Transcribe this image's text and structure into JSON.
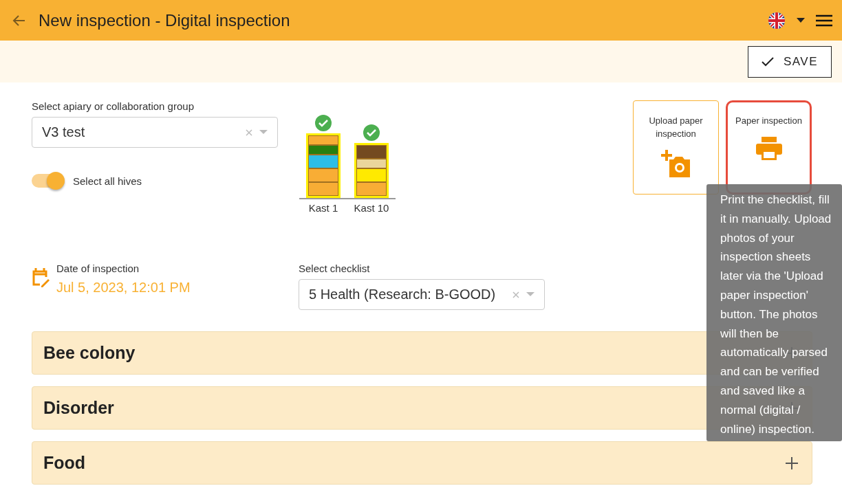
{
  "header": {
    "title": "New inspection - Digital inspection"
  },
  "toolbar": {
    "save_label": "SAVE"
  },
  "apiary": {
    "label": "Select apiary or collaboration group",
    "value": "V3 test"
  },
  "select_all": {
    "label": "Select all hives",
    "on": true
  },
  "hives": [
    {
      "name": "Kast 1",
      "checked": true,
      "layers": [
        {
          "color": "#f8ad35",
          "kind": "thin"
        },
        {
          "color": "#287f10",
          "kind": "thin"
        },
        {
          "color": "#2dbee6",
          "kind": "full"
        },
        {
          "color": "#f8ad35",
          "kind": "full"
        },
        {
          "color": "#f8ad35",
          "kind": "full"
        }
      ]
    },
    {
      "name": "Kast 10",
      "checked": true,
      "layers": [
        {
          "color": "#744a20",
          "kind": "full"
        },
        {
          "color": "#ead59c",
          "kind": "thin"
        },
        {
          "color": "#ffea00",
          "kind": "full"
        },
        {
          "color": "#f8ad35",
          "kind": "full"
        }
      ]
    }
  ],
  "cards": [
    {
      "label": "Upload paper inspection",
      "kind": "camera",
      "selected": false
    },
    {
      "label": "Paper inspection",
      "kind": "printer",
      "selected": true
    }
  ],
  "date": {
    "label": "Date of inspection",
    "value": "Jul 5, 2023, 12:01 PM"
  },
  "checklist": {
    "label": "Select checklist",
    "value": "5 Health (Research: B-GOOD)"
  },
  "sections": [
    {
      "title": "Bee colony",
      "expanded": false
    },
    {
      "title": "Disorder",
      "expanded": false
    },
    {
      "title": "Food",
      "expanded": false
    }
  ],
  "tooltip": {
    "text": "Print the checklist, fill it in manually. Upload photos of your inspection sheets later via the 'Upload paper inspection' button. The photos will then be automatically parsed and can be verified and saved like a normal (digital / online) inspection."
  }
}
